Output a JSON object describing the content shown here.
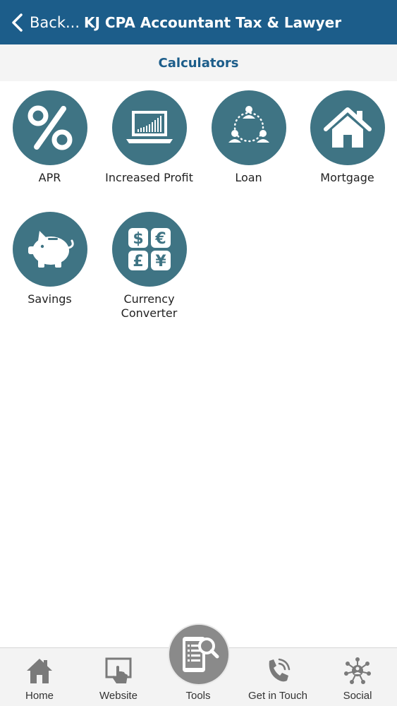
{
  "header": {
    "back_label": "Back...",
    "title": "KJ CPA Accountant Tax & Lawyer",
    "background": "#1c5d8a"
  },
  "subheader": {
    "title": "Calculators"
  },
  "calculators": [
    {
      "label": "APR",
      "icon": "percent-icon"
    },
    {
      "label": "Increased Profit",
      "icon": "laptop-chart-icon"
    },
    {
      "label": "Loan",
      "icon": "people-network-icon"
    },
    {
      "label": "Mortgage",
      "icon": "house-icon"
    },
    {
      "label": "Savings",
      "icon": "piggy-bank-icon"
    },
    {
      "label_line1": "Currency",
      "label_line2": "Converter",
      "icon": "currency-icon"
    }
  ],
  "tabbar": {
    "items": [
      {
        "label": "Home",
        "icon": "home-icon"
      },
      {
        "label": "Website",
        "icon": "touch-screen-icon"
      },
      {
        "label": "Tools",
        "icon": "tablet-search-icon"
      },
      {
        "label": "Get in Touch",
        "icon": "phone-icon"
      },
      {
        "label": "Social",
        "icon": "social-network-icon"
      }
    ]
  },
  "colors": {
    "accent": "#1c5d8a",
    "tile": "#3f7484",
    "tab_icon": "#7a7a7a"
  }
}
